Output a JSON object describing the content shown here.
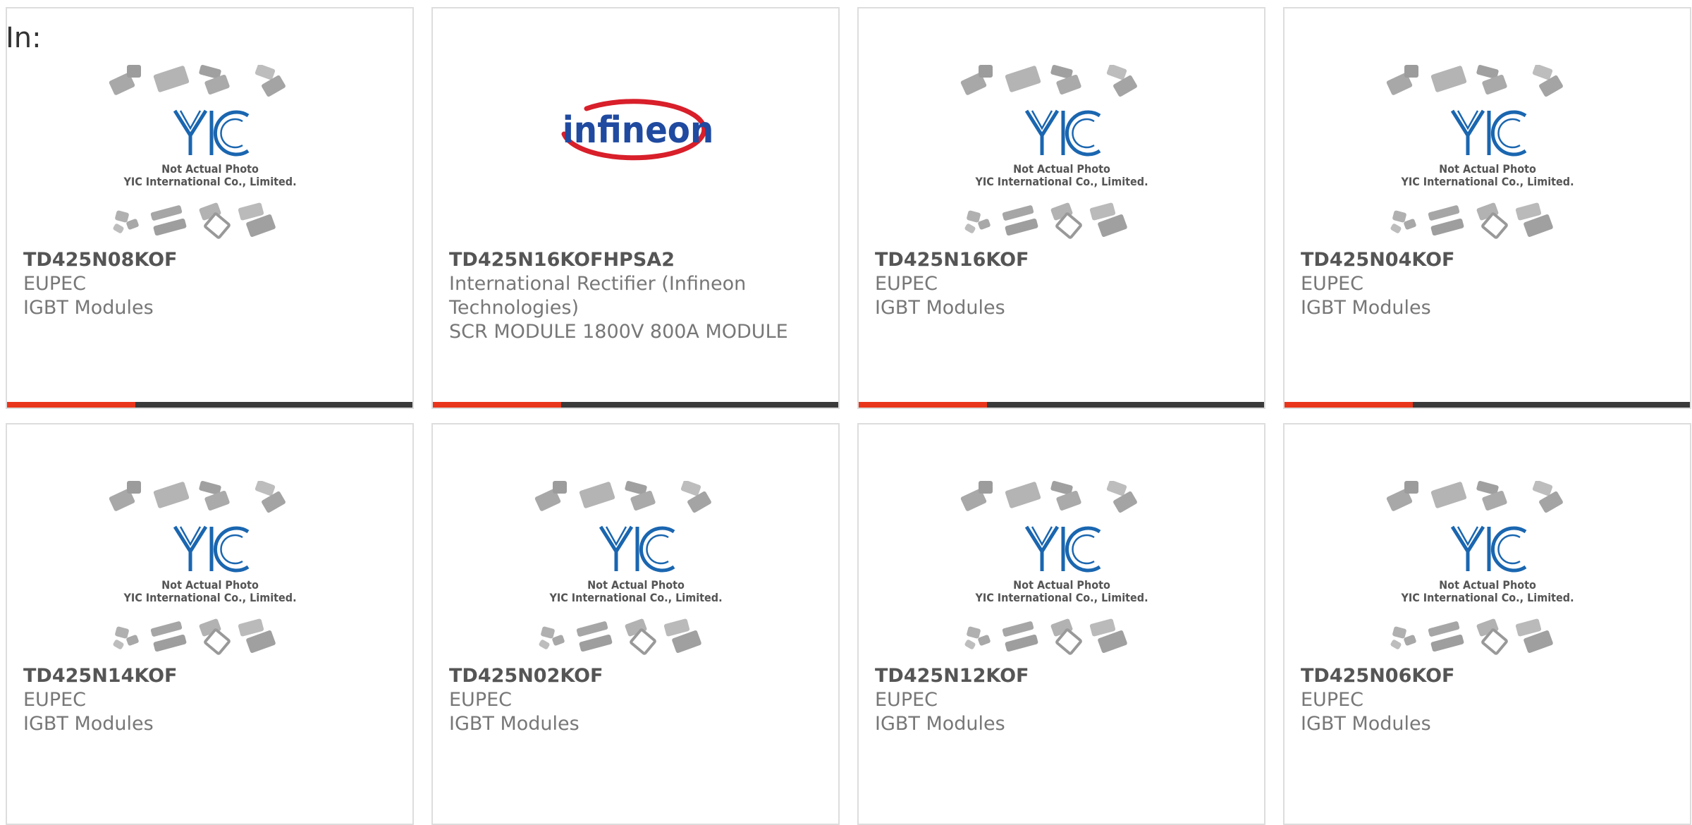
{
  "heading": "In:",
  "colors": {
    "accent": "#e8351b",
    "bar_dark": "#3a3a3a",
    "yic_blue": "#1a66b0",
    "infineon_red": "#d81f2a",
    "infineon_blue": "#1f4aa0"
  },
  "placeholder": {
    "line1": "Not Actual Photo",
    "line2": "YIC International Co., Limited.",
    "logo_text": "YIC"
  },
  "infineon_logo_text": "infineon",
  "products": [
    {
      "part": "TD425N08KOF",
      "maker": "EUPEC",
      "category": "IGBT Modules",
      "image": "yic-placeholder",
      "bar": true
    },
    {
      "part": "TD425N16KOFHPSA2",
      "maker": "International Rectifier (Infineon Technologies)",
      "category": "SCR MODULE 1800V 800A MODULE",
      "image": "infineon-logo",
      "bar": true
    },
    {
      "part": "TD425N16KOF",
      "maker": "EUPEC",
      "category": "IGBT Modules",
      "image": "yic-placeholder",
      "bar": true
    },
    {
      "part": "TD425N04KOF",
      "maker": "EUPEC",
      "category": "IGBT Modules",
      "image": "yic-placeholder",
      "bar": true
    },
    {
      "part": "TD425N14KOF",
      "maker": "EUPEC",
      "category": "IGBT Modules",
      "image": "yic-placeholder",
      "bar": false
    },
    {
      "part": "TD425N02KOF",
      "maker": "EUPEC",
      "category": "IGBT Modules",
      "image": "yic-placeholder",
      "bar": false
    },
    {
      "part": "TD425N12KOF",
      "maker": "EUPEC",
      "category": "IGBT Modules",
      "image": "yic-placeholder",
      "bar": false
    },
    {
      "part": "TD425N06KOF",
      "maker": "EUPEC",
      "category": "IGBT Modules",
      "image": "yic-placeholder",
      "bar": false
    }
  ]
}
